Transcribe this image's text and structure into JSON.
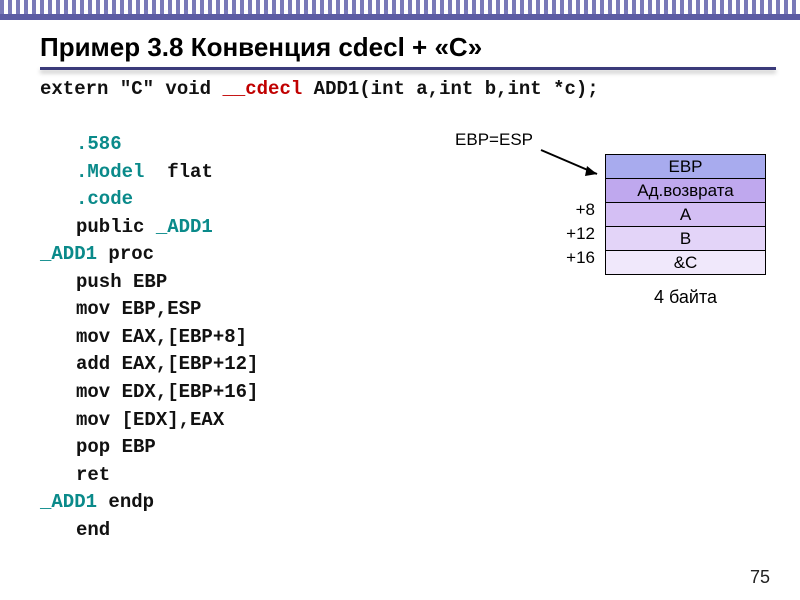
{
  "title": "Пример 3.8 Конвенция cdecl + «С»",
  "code": {
    "decl_prefix": "extern \"C\" void ",
    "decl_cdecl": "__cdecl",
    "decl_suffix": " ADD1(int a,int b,int *c);",
    "l586": ".586",
    "lmodel": ".Model",
    "lmodel_arg": "flat",
    "lcode": ".code",
    "lpublic": "public ",
    "lpublic_sym": "_ADD1",
    "lprocsym": "_ADD1",
    "lproc": " proc",
    "lpush": "push   EBP",
    "lmov1": "mov   EBP,ESP",
    "lmov2": "mov   EAX,[EBP+8]",
    "ladd": "add   EAX,[EBP+12]",
    "lmov3": "mov       EDX,[EBP+16]",
    "lmov4": "mov   [EDX],EAX",
    "lpop": "pop   EBP",
    "lret": "ret",
    "lendpsym": "_ADD1",
    "lendp": " endp",
    "lend": "end"
  },
  "stack": {
    "pointer_label": "EBP=ESP",
    "rows": [
      {
        "label": "EBP"
      },
      {
        "label": "Ад.возврата"
      },
      {
        "label": "A"
      },
      {
        "label": "B"
      },
      {
        "label": "&C"
      }
    ],
    "offsets": {
      "o8": "+8",
      "o12": "+12",
      "o16": "+16"
    },
    "caption": "4 байта"
  },
  "page_number": "75"
}
